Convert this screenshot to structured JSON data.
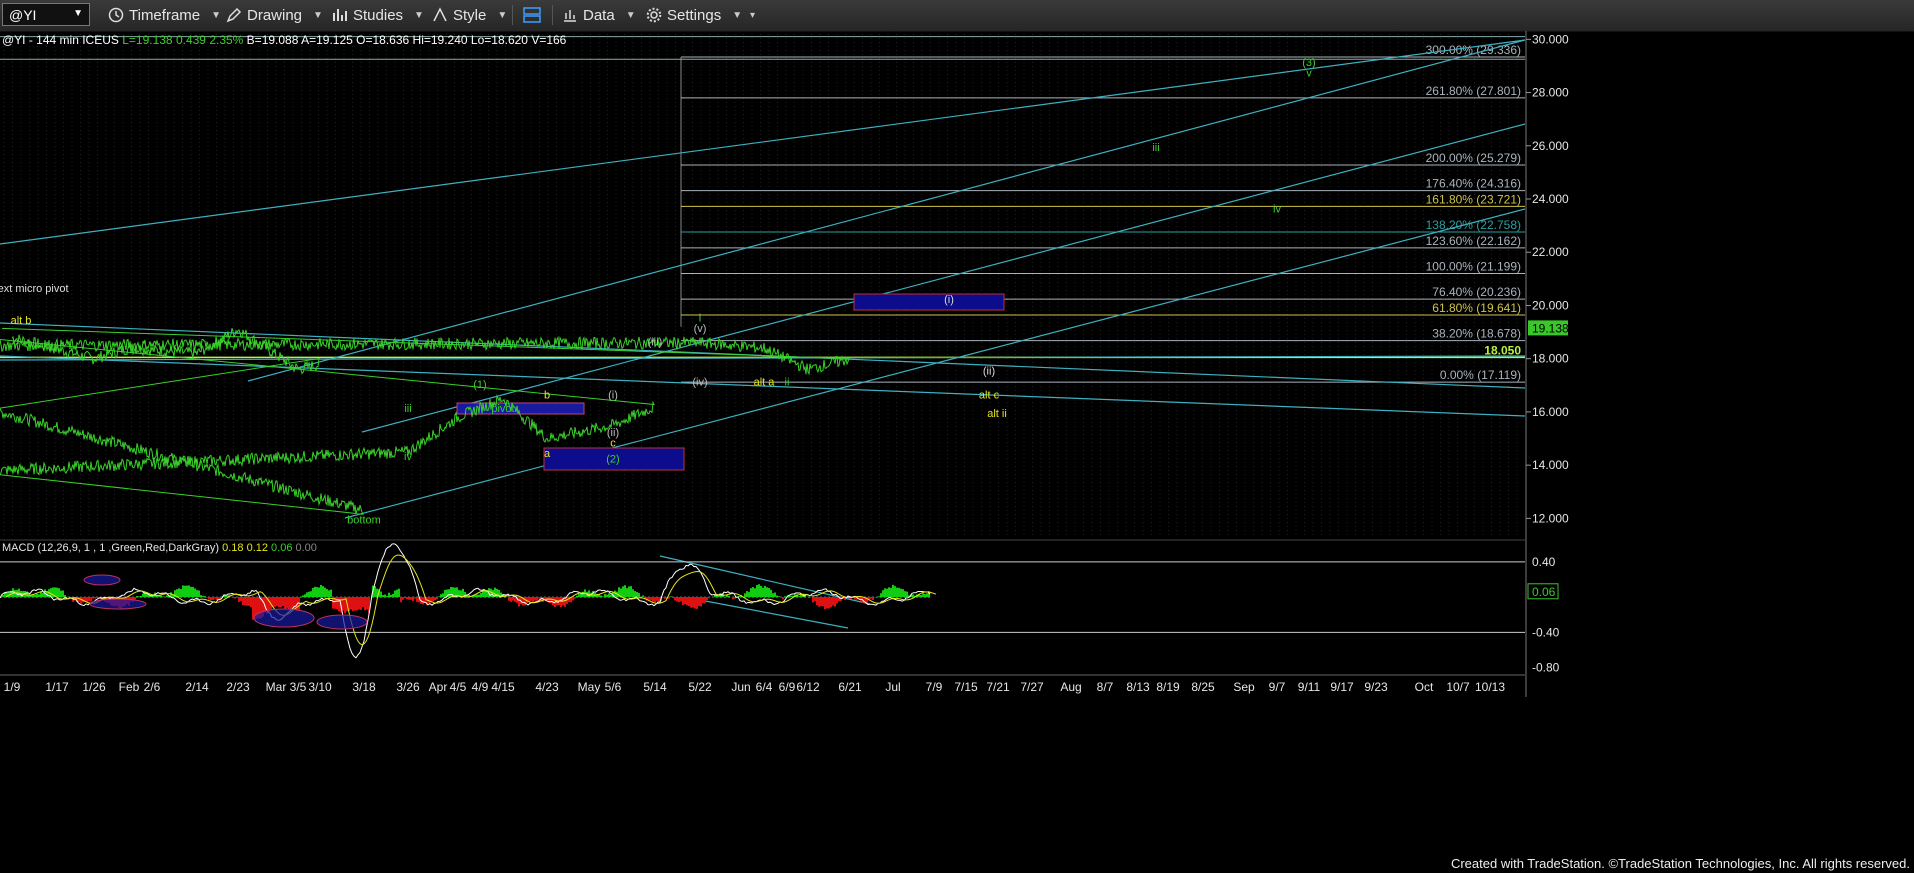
{
  "toolbar": {
    "symbol": "@YI",
    "timeframe": "Timeframe",
    "drawing": "Drawing",
    "studies": "Studies",
    "style": "Style",
    "data": "Data",
    "settings": "Settings"
  },
  "header": {
    "symbol": "@YI - 144 min",
    "exchange": "ICEUS",
    "last": "L=19.138",
    "change": "0.439",
    "change_pct": "2.35%",
    "bid": "B=19.088",
    "ask": "A=19.125",
    "open": "O=18.636",
    "high": "Hi=19.240",
    "low": "Lo=18.620",
    "volume": "V=166"
  },
  "footer": "Created with TradeStation. ©TradeStation Technologies, Inc. All rights reserved.",
  "colors": {
    "price": "#39d02a",
    "trendline": "#3db0c0",
    "fib_line": "#a9b3bd",
    "level_line": "#b7f53c",
    "wave_green": "#39d02a",
    "wave_yellow": "#e5e51a",
    "wave_white": "#dddddd",
    "box_fill": "#0c0c8c",
    "box_border": "#c23030",
    "macd_pos": "#11cc11",
    "macd_neg": "#dd1111"
  },
  "chart_data": {
    "type": "line",
    "title": "",
    "ylim": [
      11.3,
      30.2
    ],
    "y_ticks": [
      "30.000",
      "28.000",
      "26.000",
      "24.000",
      "22.000",
      "20.000",
      "18.000",
      "16.000",
      "14.000",
      "12.000"
    ],
    "x_ticks": [
      "1/9",
      "1/17",
      "1/26",
      "Feb",
      "2/6",
      "2/14",
      "2/23",
      "Mar",
      "3/5",
      "3/10",
      "3/18",
      "3/26",
      "Apr",
      "4/5",
      "4/9",
      "4/15",
      "4/23",
      "May",
      "5/6",
      "5/14",
      "5/22",
      "Jun",
      "6/4",
      "6/9",
      "6/12",
      "6/21",
      "Jul",
      "7/9",
      "7/15",
      "7/21",
      "7/27",
      "Aug",
      "8/7",
      "8/13",
      "8/19",
      "8/25",
      "Sep",
      "9/7",
      "9/11",
      "9/17",
      "9/23",
      "Oct",
      "10/7",
      "10/13"
    ],
    "price_series": {
      "name": "@YI",
      "x": [
        "1/9",
        "1/26",
        "Feb",
        "2/14",
        "2/23",
        "3/5",
        "3/10",
        "3/14",
        "3/18",
        "3/22",
        "3/26",
        "4/5",
        "4/15",
        "4/23",
        "5/6",
        "5/14",
        "5/18",
        "5/22",
        "6/4",
        "6/12",
        "6/21",
        "7/5"
      ],
      "y": [
        18.8,
        18.0,
        18.4,
        18.2,
        19.1,
        17.6,
        17.8,
        16.0,
        12.3,
        13.8,
        14.5,
        15.8,
        16.5,
        15.0,
        15.5,
        16.2,
        18.5,
        18.6,
        18.4,
        17.6,
        18.0,
        19.14
      ]
    },
    "last_price": "19.138",
    "horizontal_level": "18.050",
    "fib_levels": [
      {
        "label": "300.00% (29.336)",
        "value": 29.336
      },
      {
        "label": "261.80% (27.801)",
        "value": 27.801
      },
      {
        "label": "200.00% (25.279)",
        "value": 25.279
      },
      {
        "label": "176.40% (24.316)",
        "value": 24.316
      },
      {
        "label": "161.80% (23.721)",
        "value": 23.721
      },
      {
        "label": "138.20% (22.758)",
        "value": 22.758
      },
      {
        "label": "123.60% (22.162)",
        "value": 22.162
      },
      {
        "label": "100.00% (21.199)",
        "value": 21.199
      },
      {
        "label": "76.40% (20.236)",
        "value": 20.236
      },
      {
        "label": "61.80% (19.641)",
        "value": 19.641
      },
      {
        "label": "38.20% (18.678)",
        "value": 18.678
      },
      {
        "label": "0.00% (17.119)",
        "value": 17.119
      }
    ],
    "wave_labels": [
      {
        "text": "bottom",
        "x": "3/18",
        "y": 11.8
      },
      {
        "text": "iii",
        "x": "3/26",
        "y": 16.0
      },
      {
        "text": "iv",
        "x": "3/26",
        "y": 14.2
      },
      {
        "text": "(1)",
        "x": "4/9",
        "y": 16.9
      },
      {
        "text": "pivot",
        "x": "4/15",
        "y": 16.0
      },
      {
        "text": "b",
        "x": "4/23",
        "y": 16.5
      },
      {
        "text": "a",
        "x": "4/23",
        "y": 14.3
      },
      {
        "text": "c",
        "x": "5/6",
        "y": 14.7
      },
      {
        "text": "(2)",
        "x": "5/6",
        "y": 14.1
      },
      {
        "text": "(i)",
        "x": "5/6",
        "y": 16.5
      },
      {
        "text": "(ii)",
        "x": "5/6",
        "y": 15.1
      },
      {
        "text": "(iii)",
        "x": "5/14",
        "y": 18.5
      },
      {
        "text": "(iv)",
        "x": "5/22",
        "y": 17.0
      },
      {
        "text": "(v)",
        "x": "5/22",
        "y": 19.0
      },
      {
        "text": "i",
        "x": "5/22",
        "y": 19.4
      },
      {
        "text": "alt a",
        "x": "6/4",
        "y": 17.0
      },
      {
        "text": "ii",
        "x": "6/9",
        "y": 17.0
      },
      {
        "text": "alt b",
        "x": "7/5",
        "y": 19.3
      },
      {
        "text": "next micro pivot",
        "x": "7/5",
        "y": 20.5
      },
      {
        "text": "(i)",
        "x": "7/9",
        "y": 20.1
      },
      {
        "text": "(ii)",
        "x": "7/9",
        "y": 17.4
      },
      {
        "text": "alt c",
        "x": "7/15",
        "y": 16.5
      },
      {
        "text": "alt ii",
        "x": "7/15",
        "y": 15.8
      },
      {
        "text": "iii",
        "x": "8/19",
        "y": 25.8
      },
      {
        "text": "iv",
        "x": "9/7",
        "y": 23.5
      },
      {
        "text": "(3)",
        "x": "9/11",
        "y": 29.0
      },
      {
        "text": "v",
        "x": "9/11",
        "y": 28.6
      }
    ],
    "macd": {
      "title": "MACD (12,26,9, 1 , 1 ,Green,Red,DarkGray)",
      "values": [
        "0.18",
        "0.12",
        "0.06",
        "0.00"
      ],
      "y_ticks": [
        "0.40",
        "-0.40",
        "-0.80"
      ],
      "last": "0.06",
      "ylim": [
        -0.85,
        0.5
      ]
    }
  }
}
